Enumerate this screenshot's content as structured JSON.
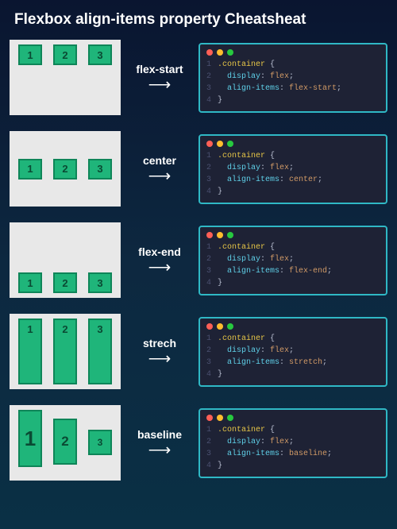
{
  "title": "Flexbox align-items property Cheatsheat",
  "boxes": {
    "b1": "1",
    "b2": "2",
    "b3": "3"
  },
  "lines": {
    "l1": "1",
    "l2": "2",
    "l3": "3",
    "l4": "4"
  },
  "code": {
    "selector": ".container",
    "open": "{",
    "close": "}",
    "displayProp": "display",
    "displayVal": "flex",
    "alignProp": "align-items",
    "colon": ": ",
    "semi": ";"
  },
  "rows": [
    {
      "label": "flex-start",
      "value": "flex-start"
    },
    {
      "label": "center",
      "value": "center"
    },
    {
      "label": "flex-end",
      "value": "flex-end"
    },
    {
      "label": "strech",
      "value": "stretch"
    },
    {
      "label": "baseline",
      "value": "baseline"
    }
  ]
}
